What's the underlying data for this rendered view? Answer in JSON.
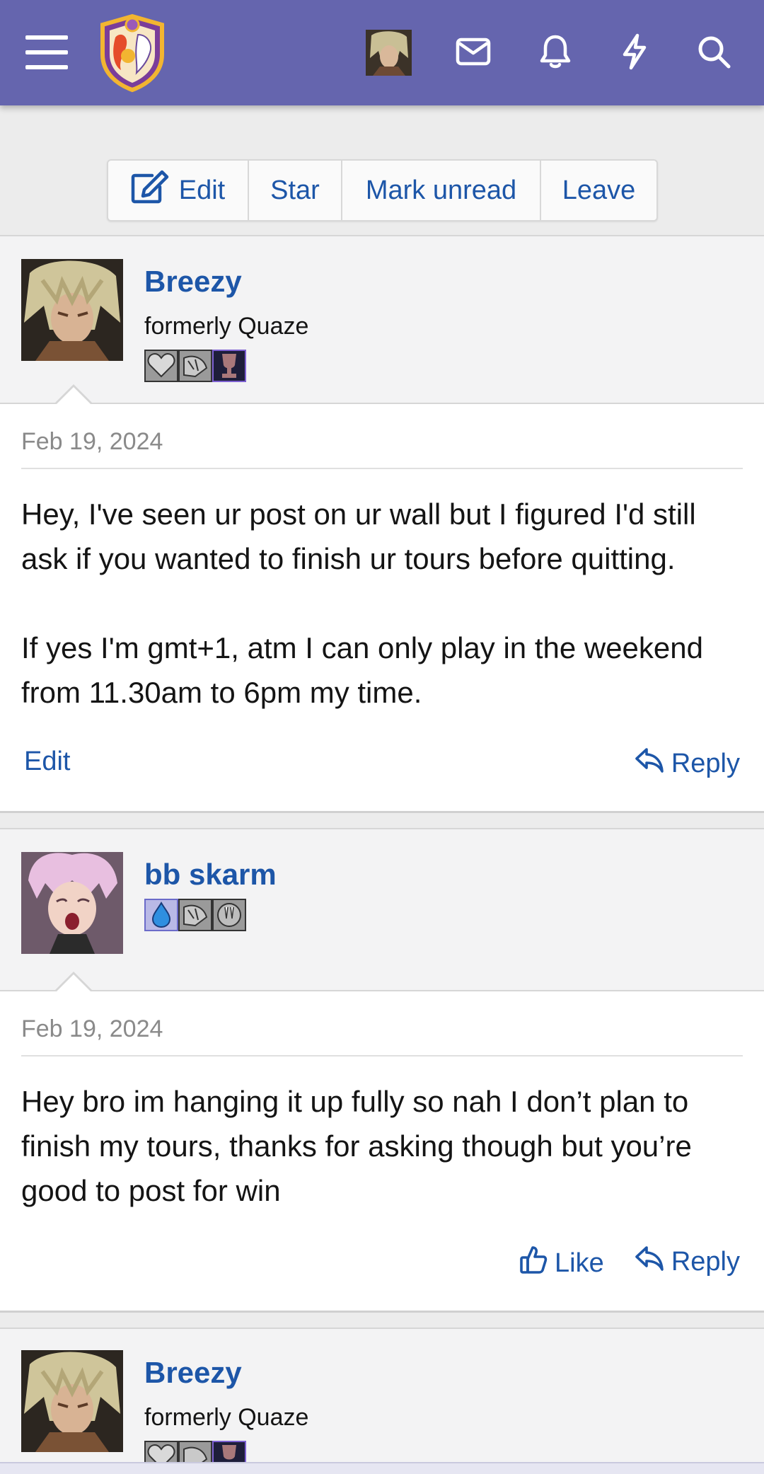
{
  "header": {
    "menu_icon": "hamburger-icon",
    "logo_icon": "forum-logo-icon",
    "avatar_icon": "user-avatar",
    "icons": [
      "mail-icon",
      "bell-icon",
      "bolt-icon",
      "search-icon"
    ],
    "colors": {
      "bar": "#6565ae",
      "link": "#1d56a8"
    }
  },
  "actions": {
    "edit": "Edit",
    "star": "Star",
    "mark_unread": "Mark unread",
    "leave": "Leave"
  },
  "posts": [
    {
      "username": "Breezy",
      "user_title": "formerly Quaze",
      "date": "Feb 19, 2024",
      "paragraphs": [
        "Hey, I've seen ur post on ur wall but I figured I'd still ask if you wanted to finish ur tours before quitting.",
        "If yes I'm gmt+1, atm I can only play in the weekend from 11.30am to 6pm my time."
      ],
      "left_action": "Edit",
      "reply": "Reply"
    },
    {
      "username": "bb skarm",
      "date": "Feb 19, 2024",
      "paragraphs": [
        "Hey bro im hanging it up fully so nah I don’t plan to finish my tours, thanks for asking though but you’re good to post for win"
      ],
      "like": "Like",
      "reply": "Reply"
    },
    {
      "username": "Breezy",
      "user_title": "formerly Quaze"
    }
  ]
}
